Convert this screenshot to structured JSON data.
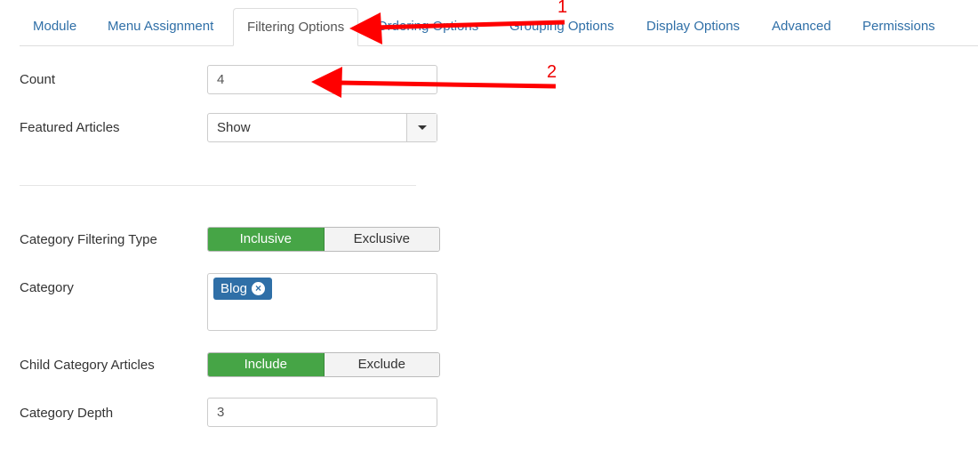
{
  "tabs": [
    {
      "label": "Module"
    },
    {
      "label": "Menu Assignment"
    },
    {
      "label": "Filtering Options",
      "active": true
    },
    {
      "label": "Ordering Options"
    },
    {
      "label": "Grouping Options"
    },
    {
      "label": "Display Options"
    },
    {
      "label": "Advanced"
    },
    {
      "label": "Permissions"
    }
  ],
  "form": {
    "count": {
      "label": "Count",
      "value": "4"
    },
    "featured": {
      "label": "Featured Articles",
      "value": "Show"
    },
    "filtering_type": {
      "label": "Category Filtering Type",
      "options": [
        "Inclusive",
        "Exclusive"
      ],
      "selected": "Inclusive"
    },
    "category": {
      "label": "Category",
      "tags": [
        "Blog"
      ]
    },
    "child_articles": {
      "label": "Child Category Articles",
      "options": [
        "Include",
        "Exclude"
      ],
      "selected": "Include"
    },
    "depth": {
      "label": "Category Depth",
      "value": "3"
    }
  },
  "annotations": {
    "arrow1": "1",
    "arrow2": "2",
    "color": "#ff0000"
  },
  "colors": {
    "link": "#2f6fa7",
    "active_toggle": "#46a546",
    "tag": "#2f6fa7"
  }
}
